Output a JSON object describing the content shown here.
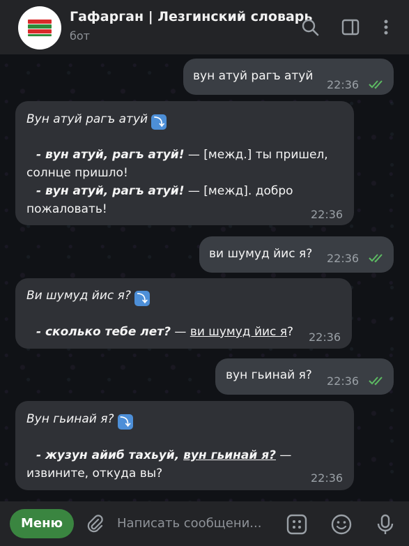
{
  "header": {
    "title": "Гафарган | Лезгинский словарь",
    "subtitle": "бот",
    "icons": [
      "search-icon",
      "sidebar-icon",
      "more-icon"
    ]
  },
  "messages": {
    "m1": {
      "text": "вун атуй рагъ атуй",
      "time": "22:36"
    },
    "m2": {
      "heading": "Вун атуй рагъ атуй",
      "l1_bold": "- вун атуй, рагъ атуй!",
      "l1_rest": " —  [межд.] ты пришел,",
      "l2": "солнце пришло!",
      "l3_bold": "- вун атуй, рагъ атуй!",
      "l3_rest": " —  [межд]. добро",
      "l4": "пожаловать!",
      "time": "22:36"
    },
    "m3": {
      "text": "ви шумуд йис я?",
      "time": "22:36"
    },
    "m4": {
      "heading": "Ви шумуд йис я?",
      "l1_bold": "- сколько тебе лет?",
      "l1_mid": " —  ",
      "l1_link": "ви шумуд йис я",
      "l1_end": "?",
      "time": "22:36"
    },
    "m5": {
      "text": "вун гьинай я?",
      "time": "22:36"
    },
    "m6": {
      "heading": "Вун гьинай я?",
      "l1_bold": "- жузун айиб тахьуй, ",
      "l1_link": "вун гьинай я?",
      "l1_rest": " —",
      "l2": "извините, откуда вы?",
      "time": "22:36"
    }
  },
  "composer": {
    "menu_label": "Меню",
    "placeholder": "Написать сообщени...",
    "icons": [
      "attach-icon",
      "keyboard-icon",
      "emoji-icon",
      "mic-icon"
    ]
  },
  "colors": {
    "header_bg": "#232427",
    "bubble_in": "#2f3136",
    "bubble_out": "#3a3e44",
    "read_ticks": "#5dbb63",
    "menu_button": "#3a8540"
  }
}
